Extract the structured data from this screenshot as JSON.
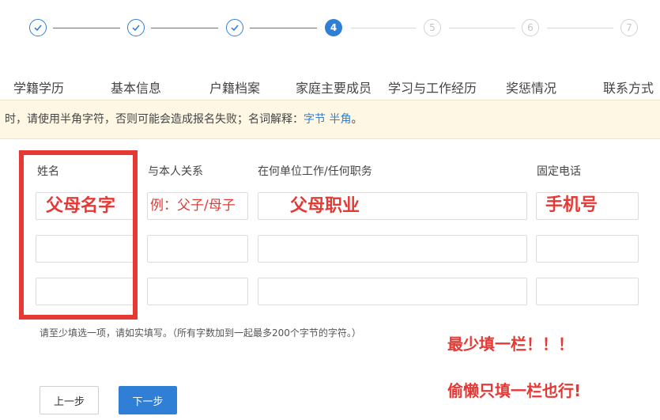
{
  "steps": [
    {
      "number": "1",
      "label": "学籍学历",
      "state": "done"
    },
    {
      "number": "2",
      "label": "基本信息",
      "state": "done"
    },
    {
      "number": "3",
      "label": "户籍档案",
      "state": "done"
    },
    {
      "number": "4",
      "label": "家庭主要成员",
      "state": "active"
    },
    {
      "number": "5",
      "label": "学习与工作经历",
      "state": "todo"
    },
    {
      "number": "6",
      "label": "奖惩情况",
      "state": "todo"
    },
    {
      "number": "7",
      "label": "联系方式",
      "state": "todo"
    }
  ],
  "notice": {
    "text": "时，请使用半角字符，否则可能会造成报名失败；名词解释：",
    "link1": "字节",
    "link2": "半角",
    "end": "。"
  },
  "form": {
    "headers": {
      "name": "姓名",
      "relation": "与本人关系",
      "work": "在何单位工作/任何职务",
      "phone": "固定电话"
    },
    "rows": [
      {
        "name": "",
        "relation": "",
        "work": "",
        "phone": ""
      },
      {
        "name": "",
        "relation": "",
        "work": "",
        "phone": ""
      },
      {
        "name": "",
        "relation": "",
        "work": "",
        "phone": ""
      }
    ],
    "hint": "请至少填选一项，请如实填写。（所有字数加到一起最多200个字节的字符。）"
  },
  "annotations": {
    "name": "父母名字",
    "relation": "例：父子/母子",
    "work": "父母职业",
    "phone": "手机号",
    "note1": "最少填一栏！！！",
    "note2": "偷懒只填一栏也行!"
  },
  "buttons": {
    "prev": "上一步",
    "next": "下一步"
  },
  "colors": {
    "accent": "#2f7fd6",
    "annotation_red": "#e53935",
    "notice_bg": "#fdf7e4"
  }
}
